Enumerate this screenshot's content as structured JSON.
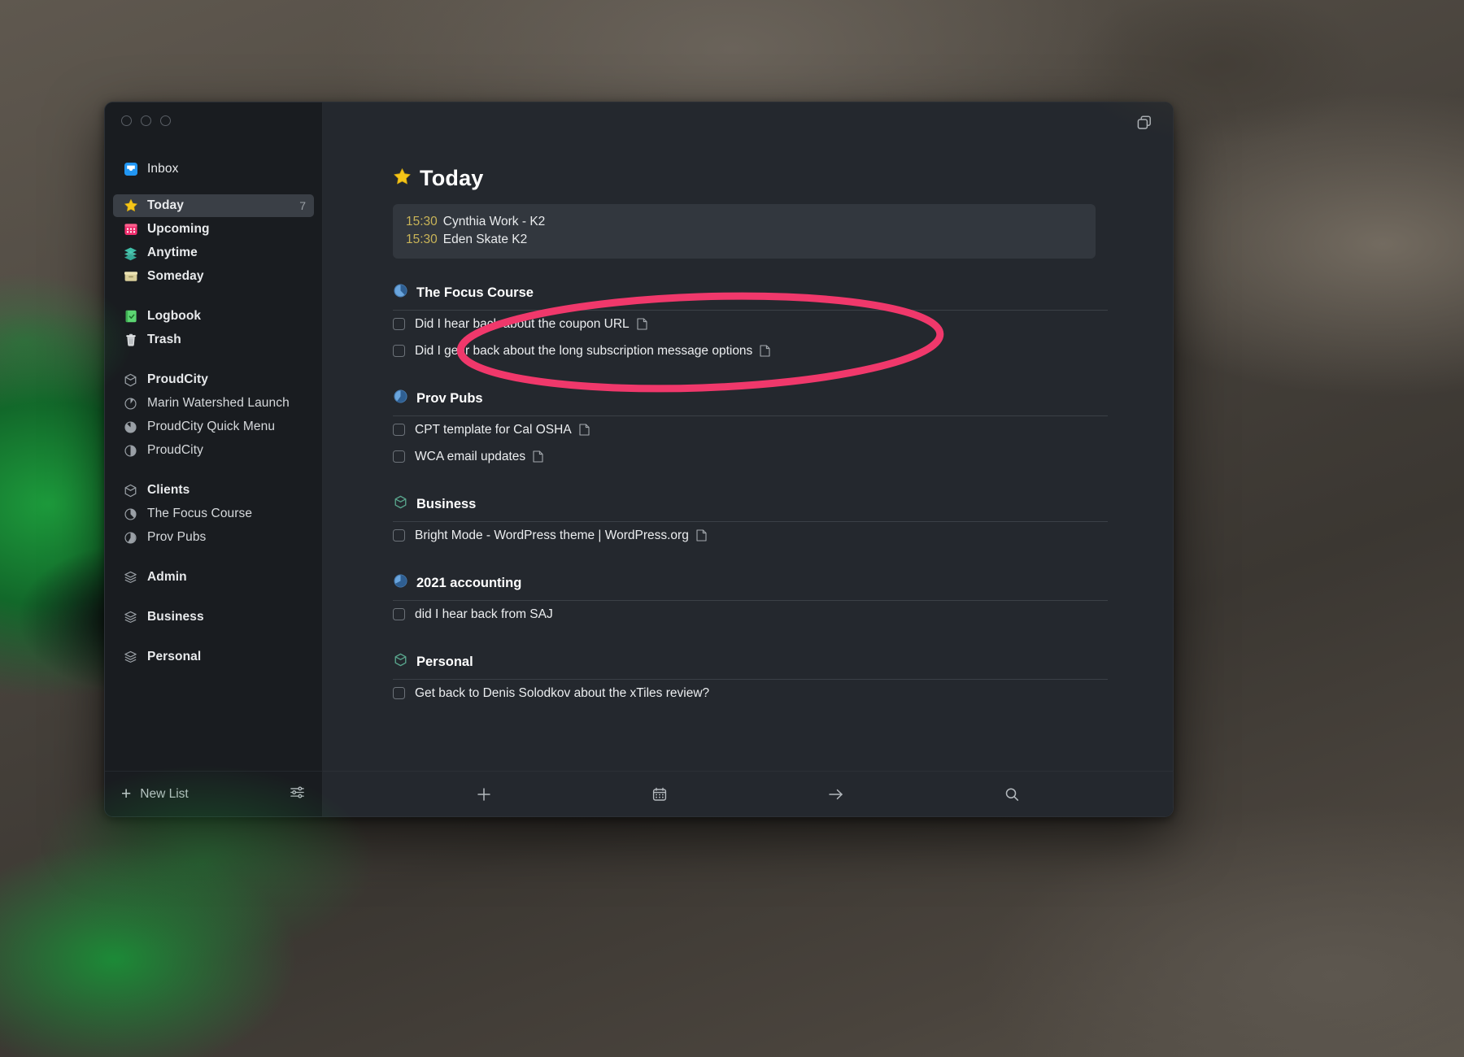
{
  "app": {
    "window_controls": [
      "close",
      "minimize",
      "zoom"
    ],
    "top_right_icon": "duplicate-windows-icon"
  },
  "sidebar": {
    "items": [
      {
        "id": "inbox",
        "label": "Inbox",
        "icon": "inbox-icon",
        "count": "",
        "type": "list",
        "selected": false
      },
      {
        "id": "today",
        "label": "Today",
        "icon": "star-icon",
        "count": "7",
        "type": "list",
        "selected": true
      },
      {
        "id": "upcoming",
        "label": "Upcoming",
        "icon": "calendar-icon",
        "count": "",
        "type": "list",
        "selected": false
      },
      {
        "id": "anytime",
        "label": "Anytime",
        "icon": "layers-icon",
        "count": "",
        "type": "list",
        "selected": false
      },
      {
        "id": "someday",
        "label": "Someday",
        "icon": "archive-box-icon",
        "count": "",
        "type": "list",
        "selected": false
      },
      {
        "id": "logbook",
        "label": "Logbook",
        "icon": "logbook-icon",
        "count": "",
        "type": "list",
        "selected": false
      },
      {
        "id": "trash",
        "label": "Trash",
        "icon": "trash-icon",
        "count": "",
        "type": "list",
        "selected": false
      }
    ],
    "areas": [
      {
        "label": "ProudCity",
        "icon": "area-hexagon-icon",
        "projects": [
          {
            "label": "Marin Watershed Launch",
            "icon": "project-progress-icon",
            "progress": 30
          },
          {
            "label": "ProudCity Quick Menu",
            "icon": "project-progress-icon",
            "progress": 55
          },
          {
            "label": "ProudCity",
            "icon": "project-progress-icon",
            "progress": 50
          }
        ]
      },
      {
        "label": "Clients",
        "icon": "area-hexagon-icon",
        "projects": [
          {
            "label": "The Focus Course",
            "icon": "project-progress-icon",
            "progress": 40
          },
          {
            "label": "Prov Pubs",
            "icon": "project-progress-icon",
            "progress": 60
          }
        ]
      },
      {
        "label": "Admin",
        "icon": "area-stack-icon",
        "projects": []
      },
      {
        "label": "Business",
        "icon": "area-stack-icon",
        "projects": []
      },
      {
        "label": "Personal",
        "icon": "area-stack-icon",
        "projects": []
      }
    ],
    "footer": {
      "new_list_label": "New List",
      "new_list_icon": "plus-icon",
      "settings_icon": "sliders-icon"
    }
  },
  "main": {
    "title": "Today",
    "title_icon": "star-icon",
    "events": [
      {
        "time": "15:30",
        "title": "Cynthia Work - K2"
      },
      {
        "time": "15:30",
        "title": "Eden Skate K2"
      }
    ],
    "groups": [
      {
        "title": "The Focus Course",
        "icon": "project-progress-icon",
        "icon_kind": "progress",
        "progress": 40,
        "tasks": [
          {
            "title": "Did I hear back about the coupon URL",
            "has_note": true,
            "checked": false
          },
          {
            "title": "Did I gear back about the long subscription message options",
            "has_note": true,
            "checked": false
          }
        ]
      },
      {
        "title": "Prov Pubs",
        "icon": "project-progress-icon",
        "icon_kind": "progress",
        "progress": 62,
        "tasks": [
          {
            "title": "CPT template for Cal OSHA",
            "has_note": true,
            "checked": false
          },
          {
            "title": "WCA email updates",
            "has_note": true,
            "checked": false
          }
        ]
      },
      {
        "title": "Business",
        "icon": "area-hexagon-icon",
        "icon_kind": "area",
        "progress": 0,
        "tasks": [
          {
            "title": "Bright Mode - WordPress theme | WordPress.org",
            "has_note": true,
            "checked": false
          }
        ]
      },
      {
        "title": "2021 accounting",
        "icon": "project-progress-icon",
        "icon_kind": "progress",
        "progress": 70,
        "tasks": [
          {
            "title": "did I hear back from SAJ",
            "has_note": false,
            "checked": false
          }
        ]
      },
      {
        "title": "Personal",
        "icon": "area-hexagon-icon",
        "icon_kind": "area",
        "progress": 0,
        "tasks": [
          {
            "title": "Get back to Denis Solodkov about the xTiles review?",
            "has_note": false,
            "checked": false
          }
        ]
      }
    ],
    "toolbar": [
      {
        "id": "new-todo",
        "icon": "plus-icon"
      },
      {
        "id": "when",
        "icon": "calendar-icon"
      },
      {
        "id": "move",
        "icon": "arrow-right-icon"
      },
      {
        "id": "search",
        "icon": "search-icon"
      }
    ]
  },
  "annotation": {
    "shape": "ellipse",
    "color": "#f0386b",
    "stroke_width": 9,
    "targets": "today-header-and-calendar-events"
  },
  "colors": {
    "accent_pink": "#f0386b",
    "event_time": "#c9b458",
    "project_blue": "#5b9bd5",
    "area_green": "#4e9d82",
    "window_bg": "#24282e",
    "sidebar_bg": "#191c20",
    "selected_row": "#3a3f46"
  }
}
